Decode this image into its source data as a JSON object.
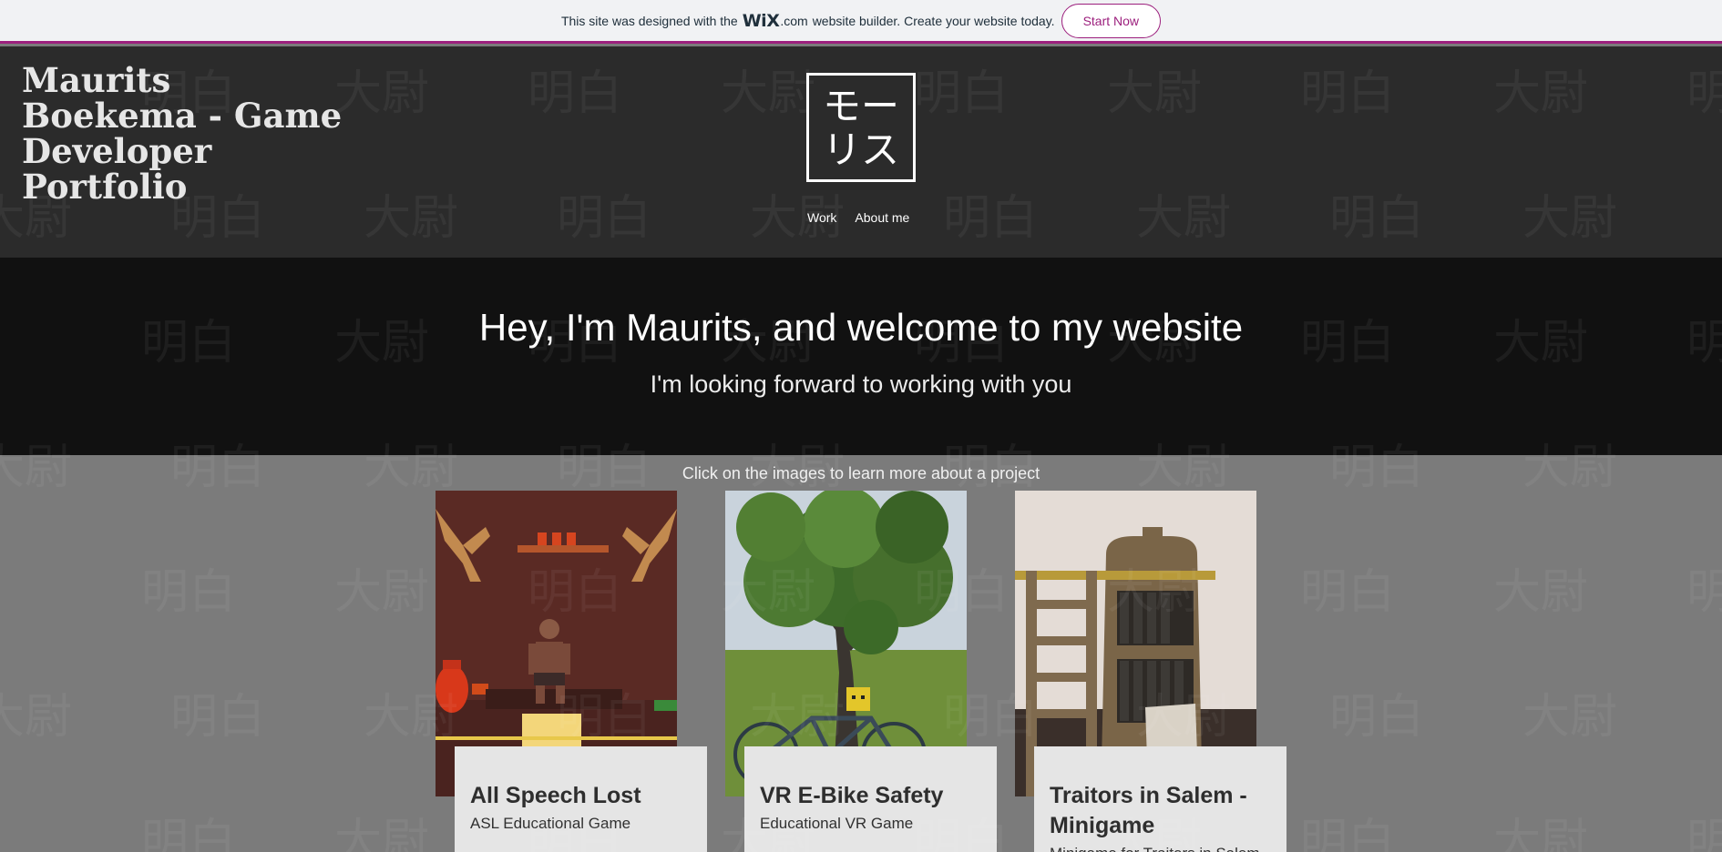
{
  "banner": {
    "text_before": "This site was designed with the",
    "wix_logo": "WiX",
    "wix_dot_com": ".com",
    "text_after": "website builder. Create your website today.",
    "cta_label": "Start Now",
    "accent_color": "#9c1f7d"
  },
  "header": {
    "site_title": "Maurits Boekema - Game Developer Portfolio",
    "logo_line1": "モー",
    "logo_line2": "リス",
    "nav": [
      {
        "label": "Work"
      },
      {
        "label": "About me"
      }
    ]
  },
  "hero": {
    "heading": "Hey, I'm Maurits, and welcome to my website",
    "subheading": "I'm looking forward to working with you"
  },
  "projects": {
    "instruction": "Click on the images to learn more about a project",
    "items": [
      {
        "title": "All Speech Lost",
        "subtitle": "ASL Educational Game",
        "image": "cabin-scene-image"
      },
      {
        "title": "VR E-Bike Safety",
        "subtitle": "Educational VR Game",
        "image": "tree-bike-scene-image"
      },
      {
        "title": "Traitors in Salem - Minigame",
        "subtitle": "Minigame for Traitors in Salem",
        "image": "bookshelf-ladder-scene-image"
      }
    ]
  },
  "watermark": {
    "glyph_a": "明白",
    "glyph_b": "大尉"
  }
}
